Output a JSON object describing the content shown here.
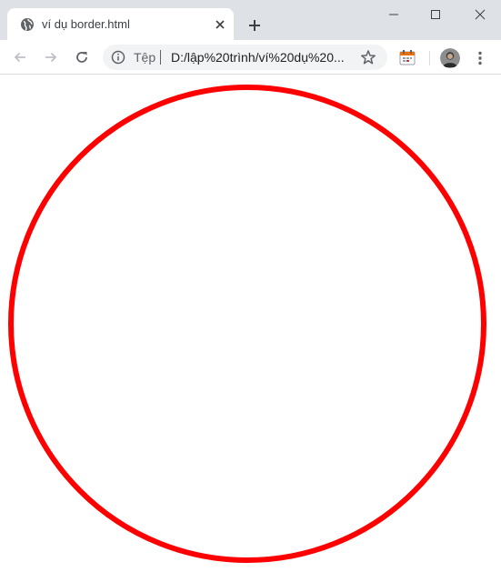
{
  "tab": {
    "title": "ví dụ border.html",
    "favicon": "globe-icon",
    "close": "close-icon"
  },
  "new_tab": "plus-icon",
  "window_controls": [
    "minimize-icon",
    "maximize-icon",
    "close-icon"
  ],
  "toolbar": {
    "back": "arrow-left-icon",
    "forward": "arrow-right-icon",
    "reload": "reload-icon",
    "extension": "calendar-extension-icon",
    "avatar": "avatar",
    "menu": "more-vert-icon"
  },
  "omnibox": {
    "info_icon": "info-icon",
    "scheme_label": "Tệp",
    "url": "D:/lập%20trình/ví%20dụ%20...",
    "star_icon": "star-icon"
  },
  "page": {
    "circle": {
      "border_color": "#ff0000",
      "background": "#ffffff"
    }
  },
  "colors": {
    "tabstrip": "#dee1e6",
    "omnibox": "#f1f3f4",
    "icon": "#5f6368"
  }
}
